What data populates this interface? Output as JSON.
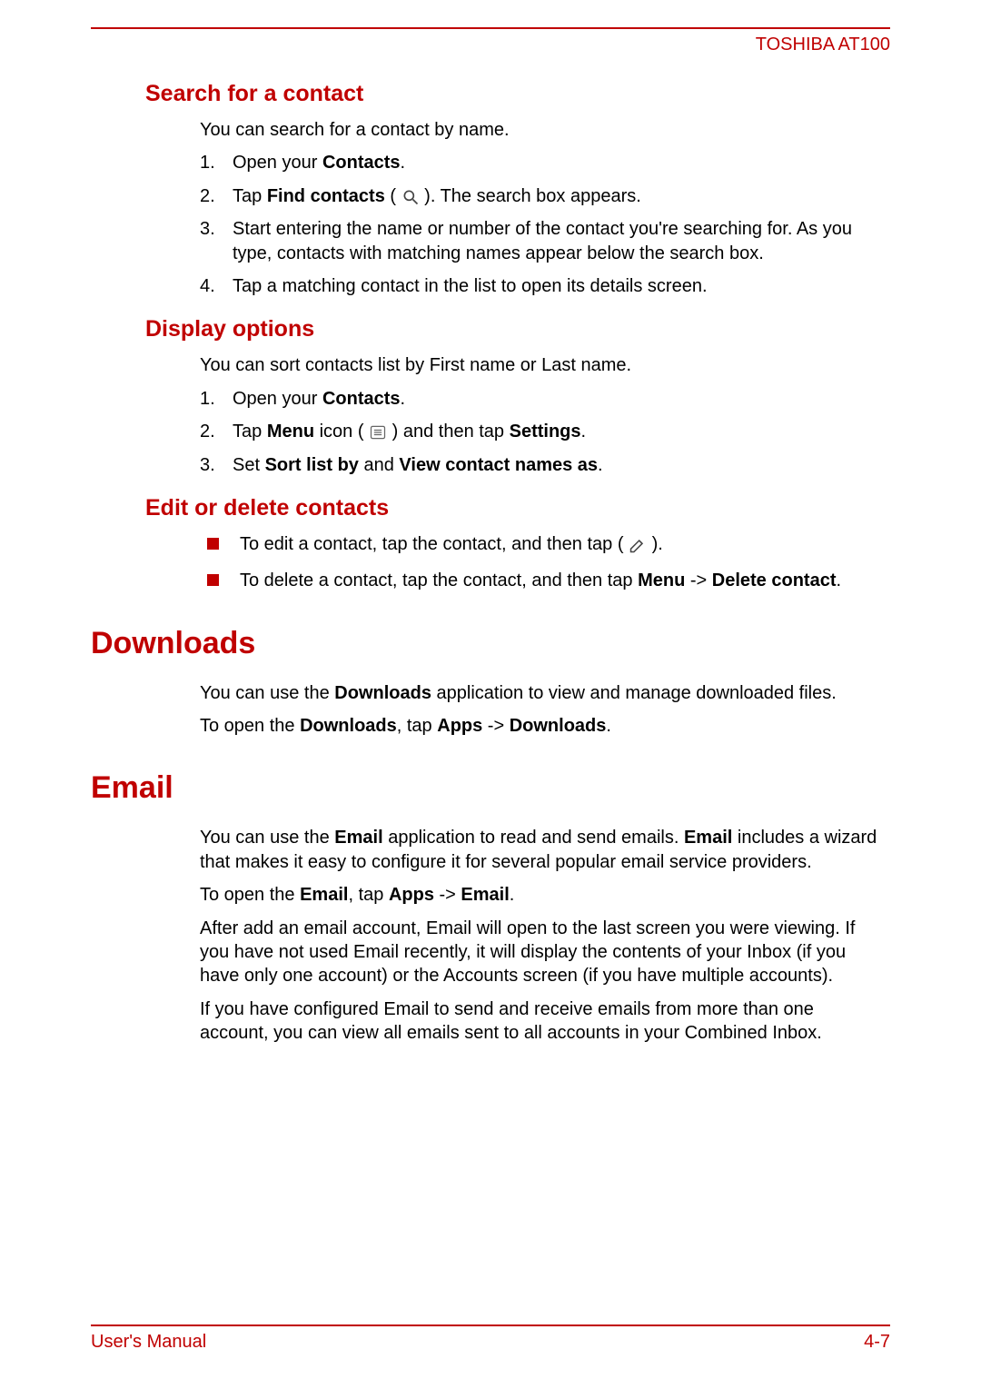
{
  "header": {
    "product": "TOSHIBA AT100"
  },
  "sections": {
    "search": {
      "title": "Search for a contact",
      "intro": "You can search for a contact by name.",
      "steps": {
        "s1_pre": "Open your ",
        "s1_bold": "Contacts",
        "s1_post": ".",
        "s2_pre": "Tap ",
        "s2_bold": "Find contacts",
        "s2_mid": " ( ",
        "s2_post": " ). The search box appears.",
        "s3": "Start entering the name or number of the contact you're searching for. As you type, contacts with matching names appear below the search box.",
        "s4": "Tap a matching contact in the list to open its details screen."
      }
    },
    "display": {
      "title": "Display options",
      "intro": "You can sort contacts list by First name or Last name.",
      "steps": {
        "s1_pre": "Open your ",
        "s1_bold": "Contacts",
        "s1_post": ".",
        "s2_pre": "Tap ",
        "s2_bold1": "Menu",
        "s2_mid1": " icon ( ",
        "s2_mid2": " ) and then tap ",
        "s2_bold2": "Settings",
        "s2_post": ".",
        "s3_pre": "Set ",
        "s3_bold1": "Sort list by",
        "s3_mid": " and ",
        "s3_bold2": "View contact names as",
        "s3_post": "."
      }
    },
    "edit": {
      "title": "Edit or delete contacts",
      "items": {
        "i1_pre": "To edit a contact, tap the contact, and then tap ( ",
        "i1_post": " ).",
        "i2_pre": "To delete a contact, tap the contact, and then tap ",
        "i2_bold1": "Menu",
        "i2_mid": " -> ",
        "i2_bold2": "Delete contact",
        "i2_post": "."
      }
    },
    "downloads": {
      "title": "Downloads",
      "p1_pre": "You can use the ",
      "p1_bold": "Downloads",
      "p1_post": " application to view and manage downloaded files.",
      "p2_pre": "To open the ",
      "p2_bold1": "Downloads",
      "p2_mid": ", tap ",
      "p2_bold2": "Apps",
      "p2_mid2": " -> ",
      "p2_bold3": "Downloads",
      "p2_post": "."
    },
    "email": {
      "title": "Email",
      "p1_pre": "You can use the ",
      "p1_bold1": "Email",
      "p1_mid": " application to read and send emails. ",
      "p1_bold2": "Email",
      "p1_post": " includes a wizard that makes it easy to configure it for several popular email service providers.",
      "p2_pre": "To open the ",
      "p2_bold1": "Email",
      "p2_mid": ", tap ",
      "p2_bold2": "Apps",
      "p2_mid2": " -> ",
      "p2_bold3": "Email",
      "p2_post": ".",
      "p3": "After add an email account, Email will open to the last screen you were viewing. If you have not used Email recently, it will display the contents of your Inbox (if you have only one account) or the Accounts screen (if you have multiple accounts).",
      "p4": "If you have configured Email to send and receive emails from more than one account, you can view all emails sent to all accounts in your Combined Inbox."
    }
  },
  "footer": {
    "left": "User's Manual",
    "right": "4-7"
  }
}
